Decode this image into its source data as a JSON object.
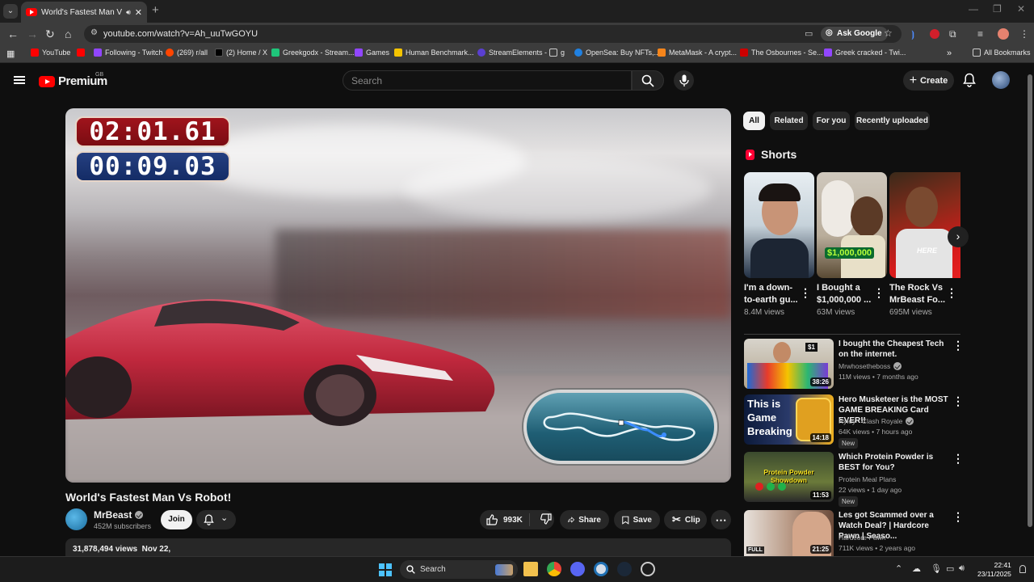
{
  "browser": {
    "tab_title": "World's Fastest Man Vs Robo",
    "url": "youtube.com/watch?v=Ah_uuTwGOYU",
    "ask_google": "Ask Google",
    "bookmarks": [
      {
        "label": "YouTube",
        "color": "#ff0000"
      },
      {
        "label": "Following - Twitch",
        "color": "#9146ff"
      },
      {
        "label": "(269) r/all",
        "color": "#ff4500"
      },
      {
        "label": "(2) Home / X",
        "color": "#000000"
      },
      {
        "label": "Greekgodx - Stream...",
        "color": "#1fc57a"
      },
      {
        "label": "Games",
        "color": "#9146ff"
      },
      {
        "label": "Human Benchmark...",
        "color": "#f5c400"
      },
      {
        "label": "StreamElements -",
        "color": "#5a3fd1"
      },
      {
        "label": "g",
        "color": "#aaaaaa"
      },
      {
        "label": "OpenSea: Buy NFTs,...",
        "color": "#2081e2"
      },
      {
        "label": "MetaMask - A crypt...",
        "color": "#f6851b"
      },
      {
        "label": "The Osbournes - Se...",
        "color": "#cc0000"
      },
      {
        "label": "Greek cracked - Twi...",
        "color": "#9146ff"
      }
    ],
    "all_bookmarks": "All Bookmarks"
  },
  "youtube": {
    "logo_text": "Premium",
    "logo_region": "GB",
    "search_placeholder": "Search",
    "create_label": "Create"
  },
  "video": {
    "timer_top": "02:01.61",
    "timer_bottom": "00:09.03",
    "title": "World's Fastest Man Vs Robot!",
    "channel": "MrBeast",
    "subscribers": "452M subscribers",
    "join_label": "Join",
    "likes": "993K",
    "share_label": "Share",
    "save_label": "Save",
    "clip_label": "Clip",
    "views": "31,878,494 views",
    "date": "Nov 22,"
  },
  "filters": [
    "All",
    "Related",
    "For you",
    "Recently uploaded"
  ],
  "shorts": {
    "heading": "Shorts",
    "items": [
      {
        "title": "I'm a down-to-earth gu...",
        "views": "8.4M views"
      },
      {
        "title": "I Bought a $1,000,000 ...",
        "views": "63M views",
        "overlay": "$1,000,000"
      },
      {
        "title": "The Rock Vs MrBeast Fo...",
        "views": "695M views",
        "overlay": "HERE"
      }
    ]
  },
  "related": [
    {
      "title": "I bought the Cheapest Tech on the internet.",
      "channel": "Mrwhosetheboss",
      "meta": "11M views • 7 months ago",
      "duration": "38:26",
      "badge": "",
      "thumb_text": "$1"
    },
    {
      "title": "Hero Musketeer is the MOST GAME BREAKING Card EVER!!",
      "channel": "Ryley - Clash Royale",
      "meta": "64K views • 7 hours ago",
      "duration": "14:18",
      "badge": "New",
      "thumb_text": "This is Game Breaking"
    },
    {
      "title": "Which Protein Powder is BEST for You?",
      "channel": "Protein Meal Plans",
      "meta": "22 views • 1 day ago",
      "duration": "11:53",
      "badge": "New",
      "thumb_text": "Protein Powder Showdown"
    },
    {
      "title": "Les got Scammed over a Watch Deal? | Hardcore Pawn | Seaso...",
      "channel": "Hardcore Pawn",
      "meta": "711K views • 2 years ago",
      "duration": "21:25",
      "badge": "",
      "thumb_text": "FULL"
    }
  ],
  "taskbar": {
    "search_label": "Search",
    "time": "22:41",
    "date": "23/11/2025"
  }
}
